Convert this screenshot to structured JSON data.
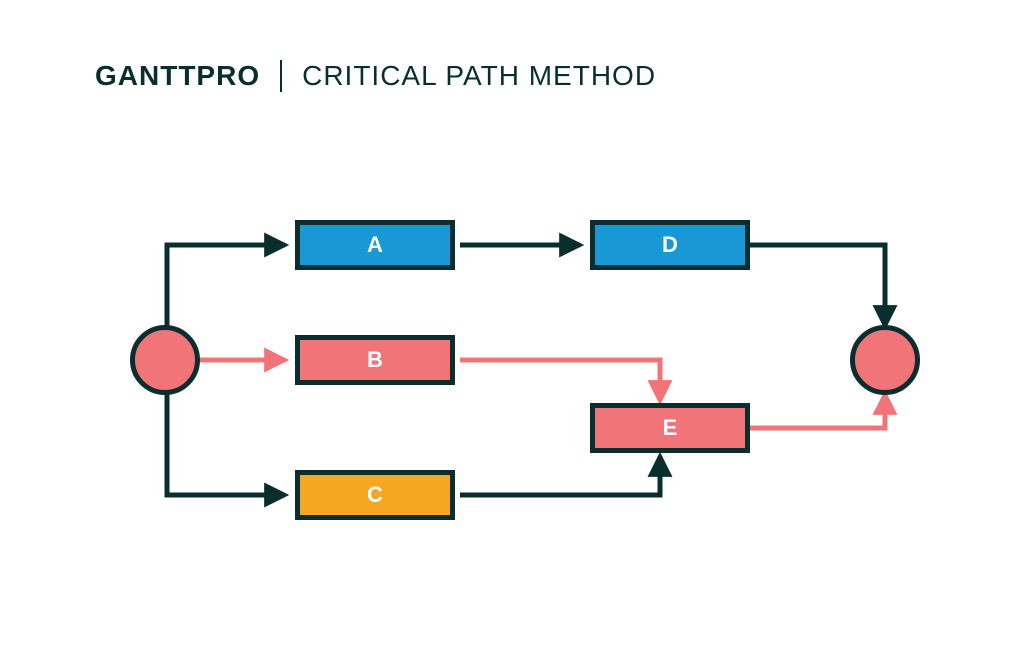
{
  "header": {
    "logo_text": "GANTTPRO",
    "title": "CRITICAL PATH METHOD"
  },
  "colors": {
    "dark": "#0a2e2e",
    "pink": "#f07478",
    "blue": "#1998d5",
    "orange": "#f5a623",
    "white": "#ffffff"
  },
  "diagram": {
    "start": {
      "fill_key": "pink"
    },
    "end": {
      "fill_key": "pink"
    },
    "boxes": {
      "A": {
        "label": "A",
        "fill_key": "blue"
      },
      "B": {
        "label": "B",
        "fill_key": "pink"
      },
      "C": {
        "label": "C",
        "fill_key": "orange"
      },
      "D": {
        "label": "D",
        "fill_key": "blue"
      },
      "E": {
        "label": "E",
        "fill_key": "pink"
      }
    },
    "edges": [
      {
        "from": "start",
        "to": "A",
        "color": "dark"
      },
      {
        "from": "start",
        "to": "B",
        "color": "pink",
        "critical": true
      },
      {
        "from": "start",
        "to": "C",
        "color": "dark"
      },
      {
        "from": "A",
        "to": "D",
        "color": "dark"
      },
      {
        "from": "B",
        "to": "E",
        "color": "pink",
        "critical": true
      },
      {
        "from": "C",
        "to": "E",
        "color": "dark"
      },
      {
        "from": "D",
        "to": "end",
        "color": "dark"
      },
      {
        "from": "E",
        "to": "end",
        "color": "pink",
        "critical": true
      }
    ],
    "critical_path": [
      "start",
      "B",
      "E",
      "end"
    ]
  }
}
